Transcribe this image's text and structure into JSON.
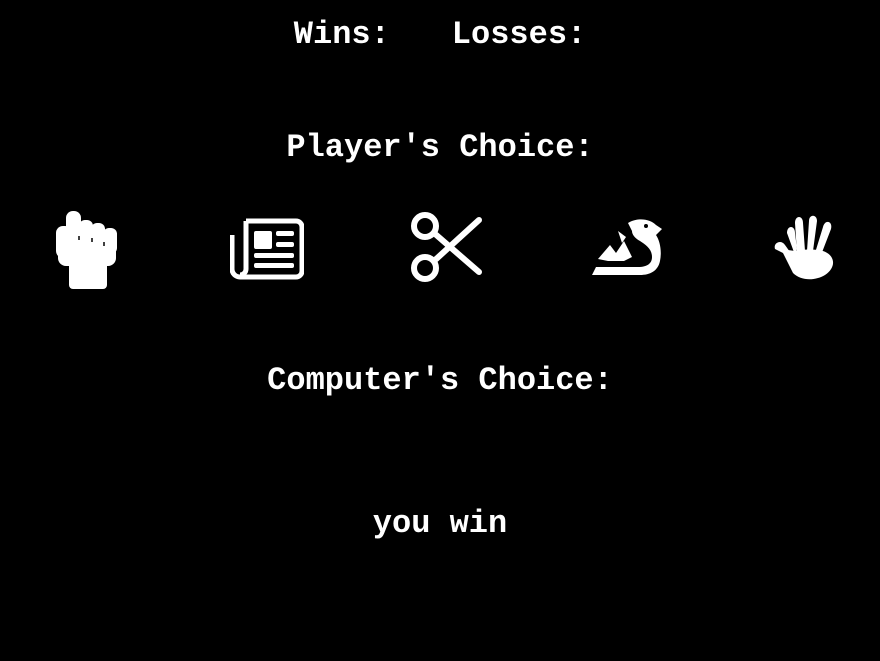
{
  "score": {
    "wins_label": "Wins:",
    "losses_label": "Losses:"
  },
  "player_choice_title": "Player's Choice:",
  "choices": [
    {
      "name": "rock",
      "icon": "fist-icon"
    },
    {
      "name": "paper",
      "icon": "newspaper-icon"
    },
    {
      "name": "scissors",
      "icon": "scissors-icon"
    },
    {
      "name": "dragon",
      "icon": "dragon-icon"
    },
    {
      "name": "spock",
      "icon": "vulcan-salute-icon"
    }
  ],
  "computer_choice_title": "Computer's Choice:",
  "result_text": "you win",
  "colors": {
    "background": "#000000",
    "foreground": "#ffffff"
  }
}
